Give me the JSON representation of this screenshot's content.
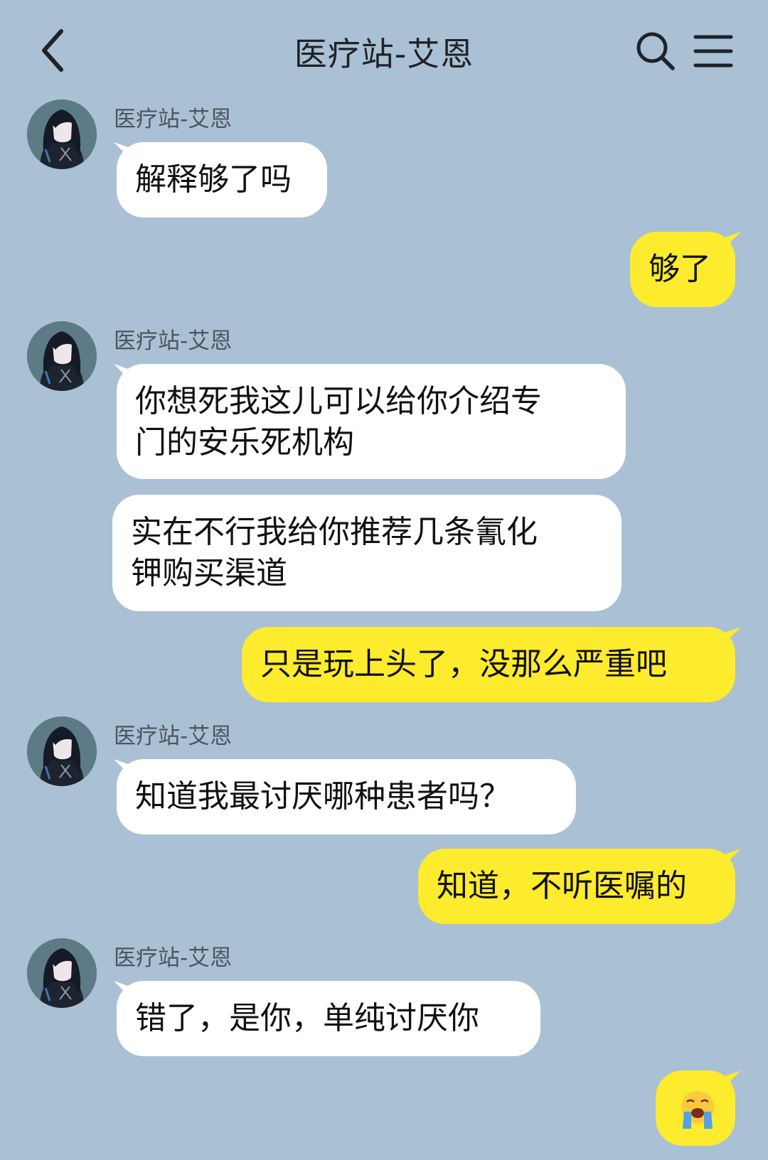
{
  "header": {
    "title": "医疗站-艾恩",
    "back_icon": "chevron-left-icon",
    "search_icon": "search-icon",
    "menu_icon": "menu-icon"
  },
  "colors": {
    "background": "#aac0d5",
    "incoming_bubble": "#ffffff",
    "outgoing_bubble": "#fdeb2e"
  },
  "messages": [
    {
      "side": "in",
      "sender": "医疗站-艾恩",
      "text": "解释够了吗"
    },
    {
      "side": "out",
      "text": "够了"
    },
    {
      "side": "in",
      "sender": "医疗站-艾恩",
      "lines": [
        "你想死我这儿可以给你介绍专",
        "门的安乐死机构"
      ]
    },
    {
      "side": "in",
      "lines": [
        "实在不行我给你推荐几条氰化",
        "钾购买渠道"
      ]
    },
    {
      "side": "out",
      "text": "只是玩上头了，没那么严重吧"
    },
    {
      "side": "in",
      "sender": "医疗站-艾恩",
      "text": "知道我最讨厌哪种患者吗？"
    },
    {
      "side": "out",
      "text": "知道，不听医嘱的"
    },
    {
      "side": "in",
      "sender": "医疗站-艾恩",
      "text": "错了，是你，单纯讨厌你"
    },
    {
      "side": "out",
      "emoji": "loudly-crying-face-emoji"
    }
  ]
}
